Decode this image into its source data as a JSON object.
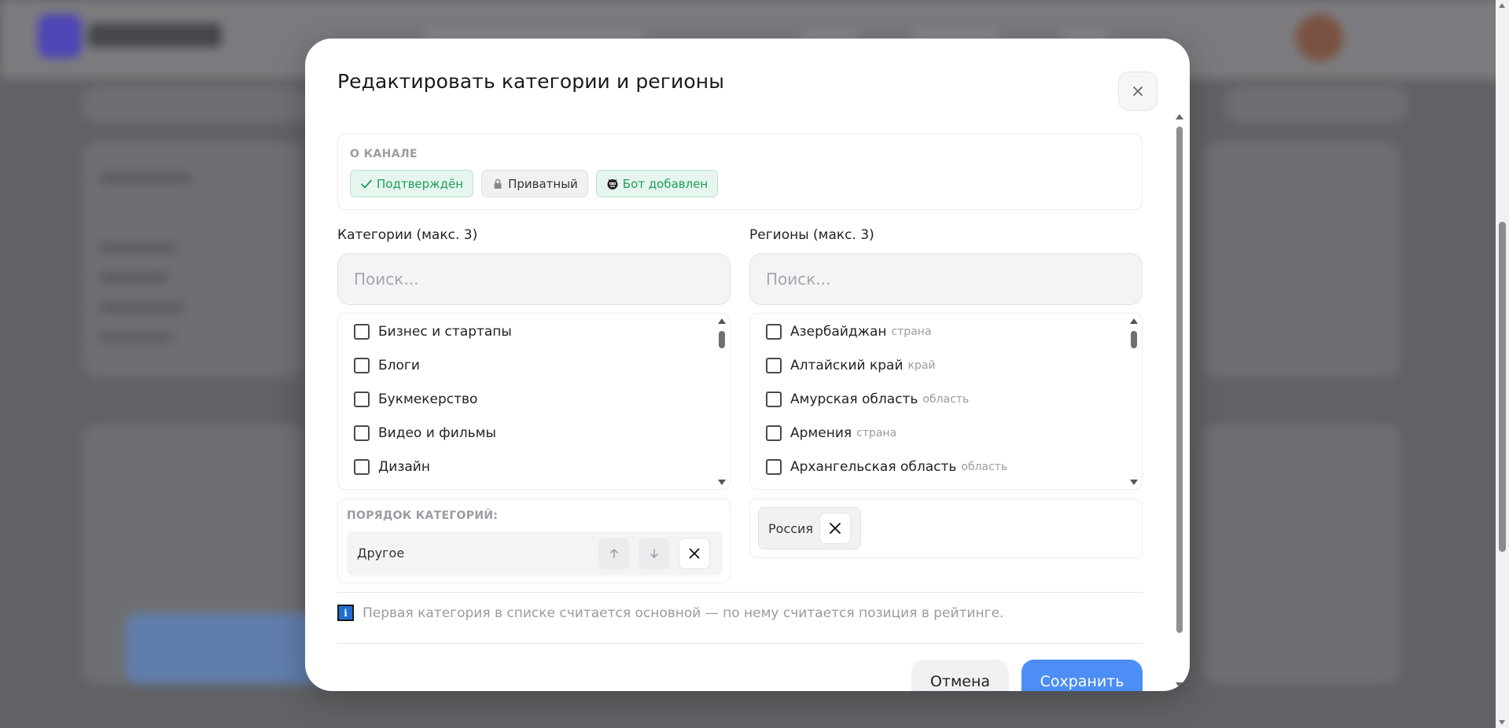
{
  "modal": {
    "title": "Редактировать категории и регионы",
    "close_icon": "close-icon"
  },
  "about": {
    "label": "О КАНАЛЕ",
    "badges": [
      {
        "label": "Подтверждён",
        "icon": "check-icon",
        "color": "#1f9d5a"
      },
      {
        "label": "Приватный",
        "icon": "lock-icon",
        "color": "#333333"
      },
      {
        "label": "Бот добавлен",
        "icon": "bot-icon",
        "color": "#1f9d5a"
      }
    ]
  },
  "categories": {
    "title": "Категории (макс. 3)",
    "search_placeholder": "Поиск...",
    "items": [
      {
        "label": "Бизнес и стартапы",
        "checked": false
      },
      {
        "label": "Блоги",
        "checked": false
      },
      {
        "label": "Букмекерство",
        "checked": false
      },
      {
        "label": "Видео и фильмы",
        "checked": false
      },
      {
        "label": "Дизайн",
        "checked": false
      }
    ],
    "order_label": "ПОРЯДОК КАТЕГОРИЙ:",
    "order": [
      {
        "label": "Другое"
      }
    ]
  },
  "regions": {
    "title": "Регионы (макс. 3)",
    "search_placeholder": "Поиск...",
    "items": [
      {
        "label": "Азербайджан",
        "type": "страна",
        "checked": false
      },
      {
        "label": "Алтайский край",
        "type": "край",
        "checked": false
      },
      {
        "label": "Амурская область",
        "type": "область",
        "checked": false
      },
      {
        "label": "Армения",
        "type": "страна",
        "checked": false
      },
      {
        "label": "Архангельская область",
        "type": "область",
        "checked": false
      }
    ],
    "selected": [
      {
        "label": "Россия"
      }
    ]
  },
  "info": {
    "icon": "info-icon",
    "text": "Первая категория в списке считается основной — по нему считается позиция в рейтинге."
  },
  "actions": {
    "cancel_label": "Отмена",
    "save_label": "Сохранить"
  },
  "colors": {
    "accent": "#4c8df6",
    "success": "#1f9d5a",
    "info": "#1f6fd1"
  }
}
